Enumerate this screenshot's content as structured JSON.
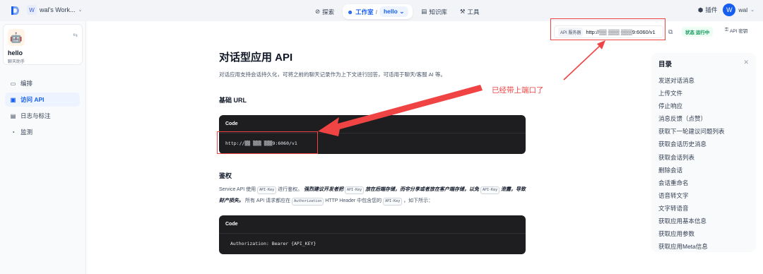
{
  "topbar": {
    "workspace_badge": "W",
    "workspace_name": "wal's Work...",
    "nav": {
      "explore": "探索",
      "studio": "工作室",
      "app_name": "hello",
      "knowledge": "知识库",
      "tools": "工具"
    },
    "plugins": "插件",
    "avatar_letter": "W",
    "user_name": "wal"
  },
  "sidebar": {
    "app_name": "hello",
    "app_type": "聊天助手",
    "items": [
      {
        "label": "编排",
        "icon": "layout-icon"
      },
      {
        "label": "访问 API",
        "icon": "terminal-icon"
      },
      {
        "label": "日志与标注",
        "icon": "log-icon"
      },
      {
        "label": "监测",
        "icon": "monitor-icon"
      }
    ],
    "active_index": 1
  },
  "header": {
    "api_server_label": "API 服务器",
    "api_server_url": "http://▒▒ ▒▒▒ ▒▒▒9:6060/v1",
    "status": "状态 运行中",
    "api_key": "API 密钥"
  },
  "doc": {
    "title": "对话型应用 API",
    "desc": "对话应用支持会话持久化，可将之前的聊天记录作为上下文进行回答，可适用于聊天/客服 AI 等。",
    "base_url_title": "基础 URL",
    "code_label": "Code",
    "base_url_code": "http://▒▒ ▒▒▒ ▒▒▒9:6060/v1",
    "auth_title": "鉴权",
    "auth_p1": "Service API 使用",
    "auth_chip_apikey": "API-Key",
    "auth_p2": "进行鉴权。",
    "auth_bold1": "强烈建议开发者把",
    "auth_bold2": "放在后端存储，而非分享或者放在客户端存储，以免",
    "auth_bold3": "泄露，导致财产损失。",
    "auth_p3": "所有 API 请求都应在",
    "auth_chip_authorization": "Authorization",
    "auth_p4": "HTTP Header 中包含您的",
    "auth_p5": "，如下所示：",
    "auth_code": "Authorization: Bearer {API_KEY}"
  },
  "annotation": "已经带上端口了",
  "toc": {
    "title": "目录",
    "items": [
      "发送对话消息",
      "上传文件",
      "停止响应",
      "消息反馈（点赞）",
      "获取下一轮建议问题列表",
      "获取会话历史消息",
      "获取会话列表",
      "删除会话",
      "会话重命名",
      "语音转文字",
      "文字转语音",
      "获取应用基本信息",
      "获取应用参数",
      "获取应用Meta信息"
    ]
  },
  "colors": {
    "accent": "#155eef",
    "annotation": "#f04444",
    "status_green": "#079455",
    "code_bg": "#1e1e20"
  }
}
